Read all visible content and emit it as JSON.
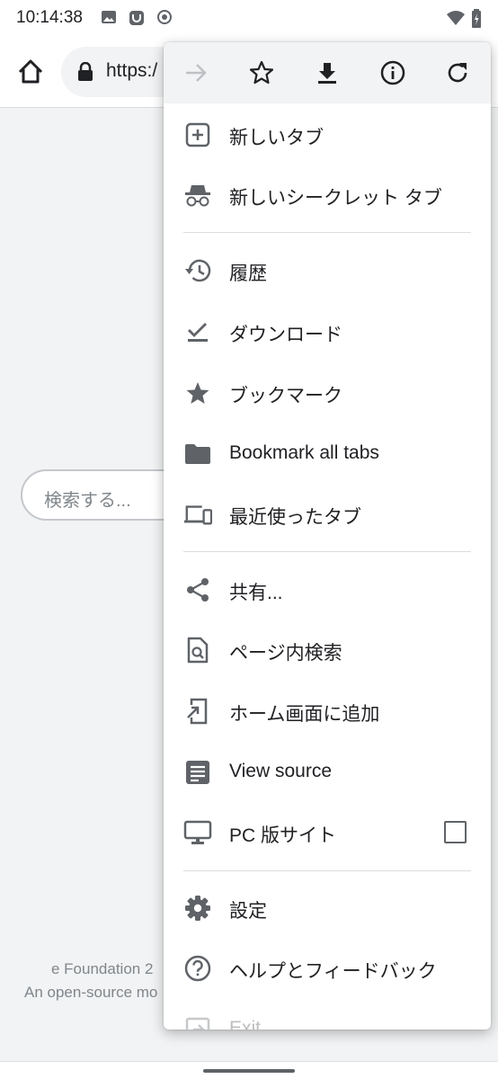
{
  "status_bar": {
    "time": "10:14:38"
  },
  "toolbar": {
    "url": "https:/"
  },
  "page": {
    "search_placeholder": "検索する...",
    "footer_line1": "e Foundation 2",
    "footer_line2": "An open-source mo"
  },
  "menu": {
    "new_tab": "新しいタブ",
    "new_incognito_tab": "新しいシークレット タブ",
    "history": "履歴",
    "downloads": "ダウンロード",
    "bookmarks": "ブックマーク",
    "bookmark_all_tabs": "Bookmark all tabs",
    "recent_tabs": "最近使ったタブ",
    "share": "共有...",
    "find_in_page": "ページ内検索",
    "add_to_home": "ホーム画面に追加",
    "view_source": "View source",
    "desktop_site": "PC 版サイト",
    "desktop_site_checked": false,
    "settings": "設定",
    "help_feedback": "ヘルプとフィードバック",
    "exit": "Exit"
  },
  "colors": {
    "icon": "#5f6368",
    "menu_bg": "#ffffff",
    "menu_top_bg": "#f1f3f4"
  }
}
